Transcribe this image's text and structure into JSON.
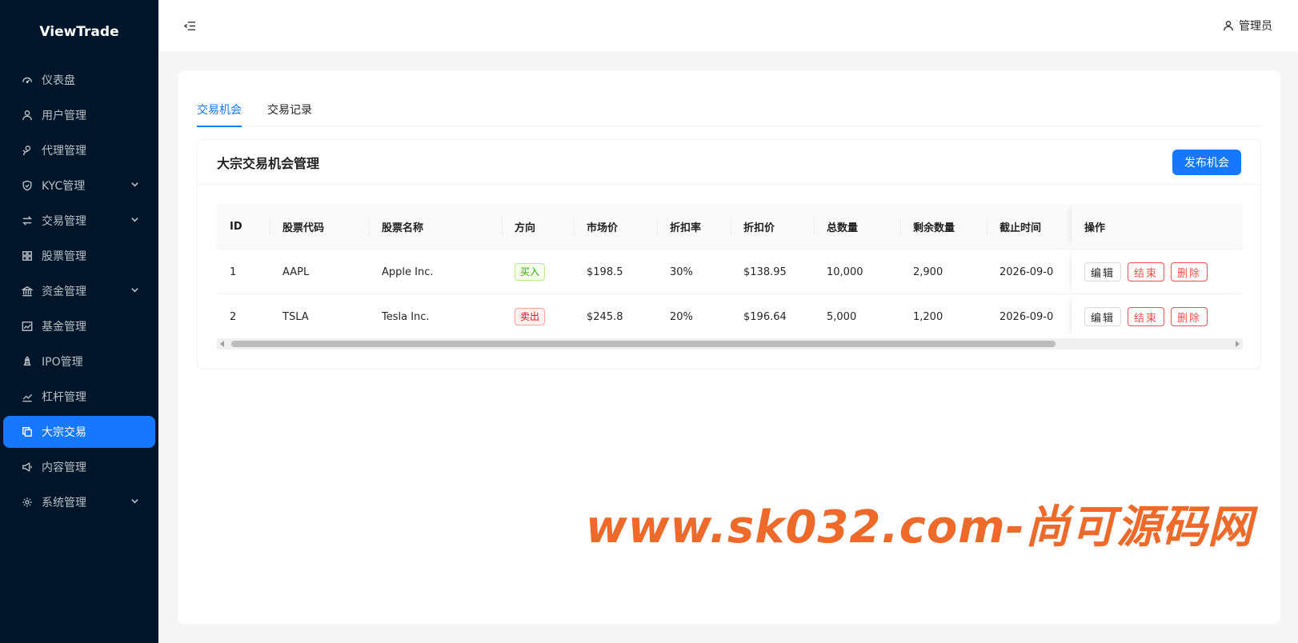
{
  "app": {
    "logo": "ViewTrade"
  },
  "sidebar": {
    "items": [
      {
        "label": "仪表盘",
        "icon": "dashboard-icon",
        "has_arrow": false,
        "active": false
      },
      {
        "label": "用户管理",
        "icon": "user-icon",
        "has_arrow": false,
        "active": false
      },
      {
        "label": "代理管理",
        "icon": "agent-icon",
        "has_arrow": false,
        "active": false
      },
      {
        "label": "KYC管理",
        "icon": "shield-icon",
        "has_arrow": true,
        "active": false
      },
      {
        "label": "交易管理",
        "icon": "swap-icon",
        "has_arrow": true,
        "active": false
      },
      {
        "label": "股票管理",
        "icon": "grid-icon",
        "has_arrow": false,
        "active": false
      },
      {
        "label": "资金管理",
        "icon": "bank-icon",
        "has_arrow": true,
        "active": false
      },
      {
        "label": "基金管理",
        "icon": "fund-chart-icon",
        "has_arrow": false,
        "active": false
      },
      {
        "label": "IPO管理",
        "icon": "rocket-icon",
        "has_arrow": false,
        "active": false
      },
      {
        "label": "杠杆管理",
        "icon": "line-chart-icon",
        "has_arrow": false,
        "active": false
      },
      {
        "label": "大宗交易",
        "icon": "copy-icon",
        "has_arrow": false,
        "active": true
      },
      {
        "label": "内容管理",
        "icon": "notification-icon",
        "has_arrow": false,
        "active": false
      },
      {
        "label": "系统管理",
        "icon": "setting-icon",
        "has_arrow": true,
        "active": false
      }
    ]
  },
  "header": {
    "user_label": "管理员"
  },
  "tabs": [
    {
      "label": "交易机会",
      "active": true
    },
    {
      "label": "交易记录",
      "active": false
    }
  ],
  "panel": {
    "title": "大宗交易机会管理",
    "publish_button": "发布机会"
  },
  "table": {
    "columns": [
      "ID",
      "股票代码",
      "股票名称",
      "方向",
      "市场价",
      "折扣率",
      "折扣价",
      "总数量",
      "剩余数量",
      "截止时间",
      "操作"
    ],
    "rows": [
      {
        "id": "1",
        "code": "AAPL",
        "name": "Apple Inc.",
        "direction": "买入",
        "direction_type": "buy",
        "market_price": "$198.5",
        "discount_rate": "30%",
        "discount_price": "$138.95",
        "total_qty": "10,000",
        "remaining_qty": "2,900",
        "deadline": "2026-09-0"
      },
      {
        "id": "2",
        "code": "TSLA",
        "name": "Tesla Inc.",
        "direction": "卖出",
        "direction_type": "sell",
        "market_price": "$245.8",
        "discount_rate": "20%",
        "discount_price": "$196.64",
        "total_qty": "5,000",
        "remaining_qty": "1,200",
        "deadline": "2026-09-0"
      }
    ],
    "actions": {
      "edit": "编辑",
      "end": "结束",
      "delete": "删除"
    }
  },
  "watermark": "www.sk032.com-尚可源码网",
  "colors": {
    "sidebar_bg": "#001529",
    "primary": "#1677ff",
    "danger": "#ff4d4f",
    "watermark": "#ee6a2a"
  }
}
